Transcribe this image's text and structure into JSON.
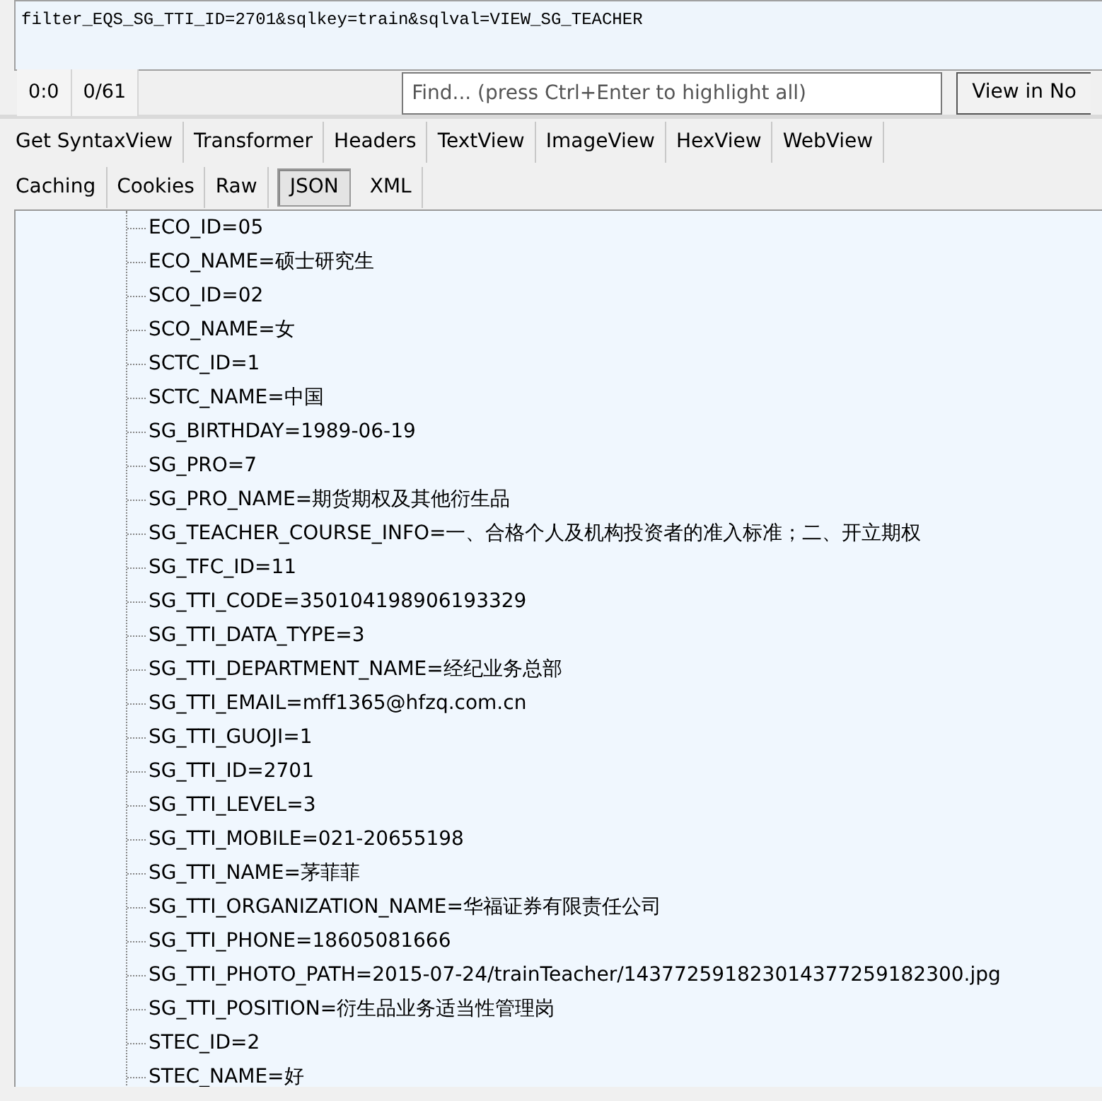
{
  "request_body": {
    "text": "filter_EQS_SG_TTI_ID=2701&sqlkey=train&sqlval=VIEW_SG_TEACHER"
  },
  "status_bar": {
    "position": "0:0",
    "count": "0/61",
    "find": {
      "placeholder": "Find... (press Ctrl+Enter to highlight all)"
    },
    "view_button": "View in No"
  },
  "tabs_row_1": [
    {
      "label": "Get SyntaxView",
      "selected": false
    },
    {
      "label": "Transformer",
      "selected": false
    },
    {
      "label": "Headers",
      "selected": false
    },
    {
      "label": "TextView",
      "selected": false
    },
    {
      "label": "ImageView",
      "selected": false
    },
    {
      "label": "HexView",
      "selected": false
    },
    {
      "label": "WebView",
      "selected": false
    }
  ],
  "tabs_row_2": [
    {
      "label": "Caching",
      "selected": false
    },
    {
      "label": "Cookies",
      "selected": false
    },
    {
      "label": "Raw",
      "selected": false
    },
    {
      "label": "JSON",
      "selected": true
    },
    {
      "label": "XML",
      "selected": false
    }
  ],
  "tree": [
    {
      "text": "ECO_ID=05"
    },
    {
      "text": "ECO_NAME=硕士研究生"
    },
    {
      "text": "SCO_ID=02"
    },
    {
      "text": "SCO_NAME=女"
    },
    {
      "text": "SCTC_ID=1"
    },
    {
      "text": "SCTC_NAME=中国"
    },
    {
      "text": "SG_BIRTHDAY=1989-06-19"
    },
    {
      "text": "SG_PRO=7"
    },
    {
      "text": "SG_PRO_NAME=期货期权及其他衍生品"
    },
    {
      "text": "SG_TEACHER_COURSE_INFO=一、合格个人及机构投资者的准入标准；二、开立期权"
    },
    {
      "text": "SG_TFC_ID=11"
    },
    {
      "text": "SG_TTI_CODE=350104198906193329"
    },
    {
      "text": "SG_TTI_DATA_TYPE=3"
    },
    {
      "text": "SG_TTI_DEPARTMENT_NAME=经纪业务总部"
    },
    {
      "text": "SG_TTI_EMAIL=mff1365@hfzq.com.cn"
    },
    {
      "text": "SG_TTI_GUOJI=1"
    },
    {
      "text": "SG_TTI_ID=2701"
    },
    {
      "text": "SG_TTI_LEVEL=3"
    },
    {
      "text": "SG_TTI_MOBILE=021-20655198"
    },
    {
      "text": "SG_TTI_NAME=茅菲菲"
    },
    {
      "text": "SG_TTI_ORGANIZATION_NAME=华福证券有限责任公司"
    },
    {
      "text": "SG_TTI_PHONE=18605081666"
    },
    {
      "text": "SG_TTI_PHOTO_PATH=2015-07-24/trainTeacher/143772591823014377259182300.jpg"
    },
    {
      "text": "SG_TTI_POSITION=衍生品业务适当性管理岗"
    },
    {
      "text": "STEC_ID=2"
    },
    {
      "text": "STEC_NAME=好"
    }
  ]
}
